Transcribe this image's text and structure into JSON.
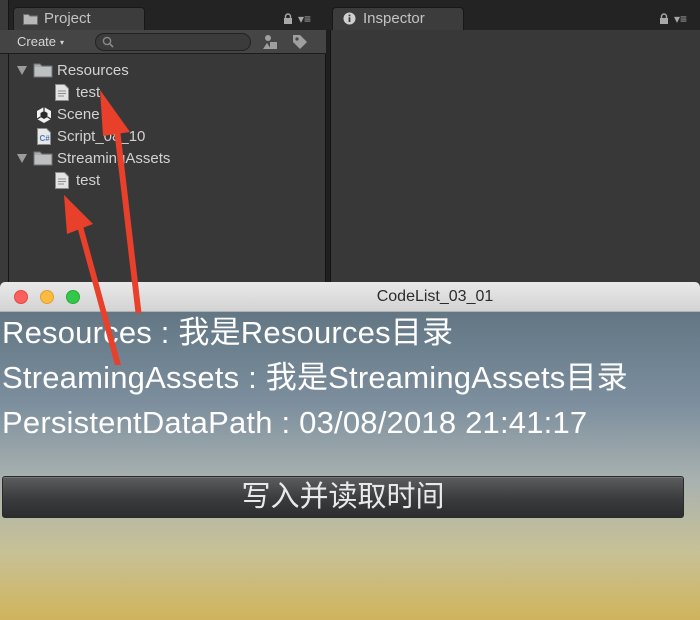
{
  "editor": {
    "project_tab": {
      "label": "Project",
      "icon": "project-folder-icon"
    },
    "inspector_tab": {
      "label": "Inspector",
      "icon": "info-icon"
    },
    "menu_glyph": "▾≡",
    "toolbar": {
      "create_label": "Create",
      "create_caret": "▾",
      "search_placeholder": ""
    },
    "tree": [
      {
        "label": "Resources",
        "type": "folder",
        "expanded": true,
        "depth": 0
      },
      {
        "label": "test",
        "type": "text-file",
        "depth": 1
      },
      {
        "label": "Scene",
        "type": "unity-scene",
        "depth": 0
      },
      {
        "label": "Script_08_10",
        "type": "csharp-script",
        "depth": 0
      },
      {
        "label": "StreamingAssets",
        "type": "folder",
        "expanded": true,
        "depth": 0
      },
      {
        "label": "test",
        "type": "text-file",
        "depth": 1
      }
    ]
  },
  "window": {
    "title": "CodeList_03_01",
    "lines": [
      "Resources : 我是Resources目录",
      "StreamingAssets : 我是StreamingAssets目录",
      "PersistentDataPath : 03/08/2018 21:41:17"
    ],
    "button_label": "写入并读取时间"
  },
  "colors": {
    "annotation_arrow": "#e8402a",
    "close": "#fc605c",
    "minimize": "#fdbc40",
    "zoom": "#34c84a"
  }
}
